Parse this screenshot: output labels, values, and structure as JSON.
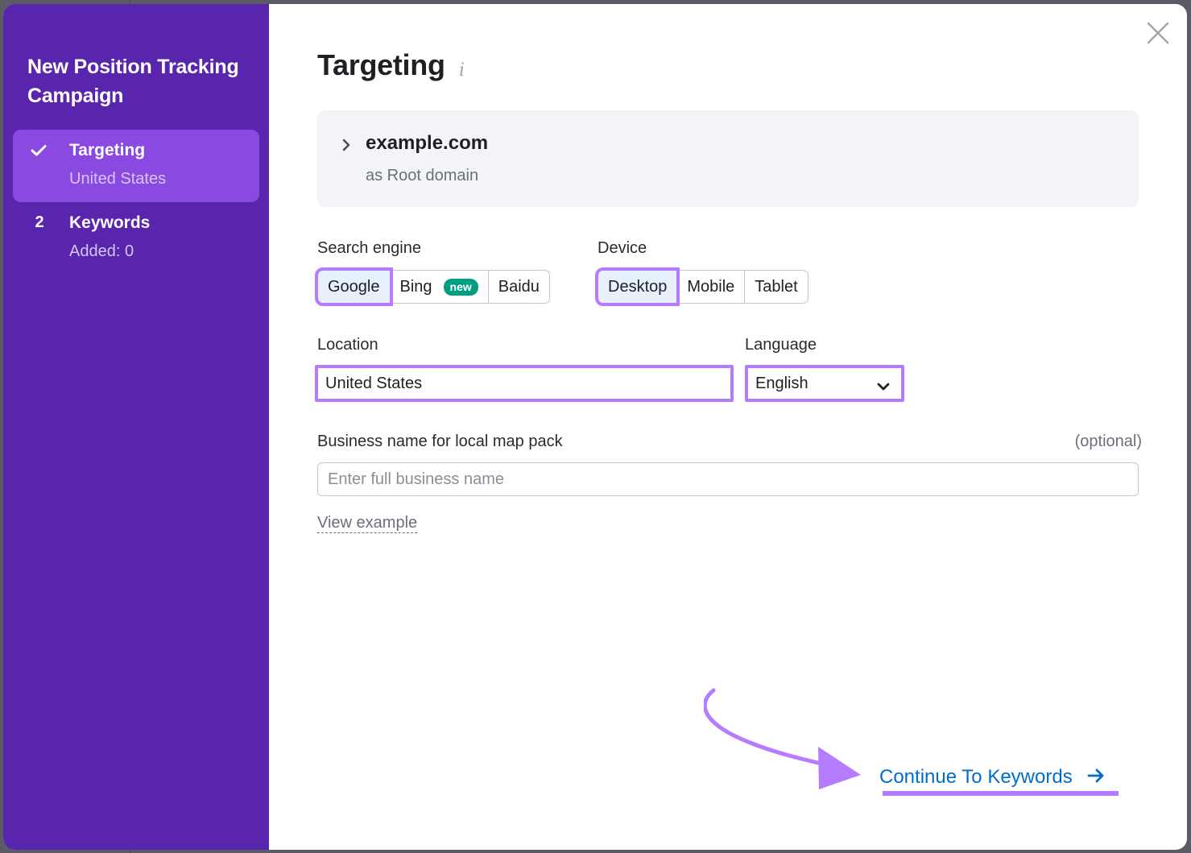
{
  "sidebar": {
    "title": "New Position Tracking Campaign",
    "steps": [
      {
        "marker": "check-icon",
        "label": "Targeting",
        "sub": "United States",
        "active": true
      },
      {
        "marker": "2",
        "label": "Keywords",
        "sub": "Added: 0",
        "active": false
      }
    ]
  },
  "main": {
    "title": "Targeting",
    "info_icon": "i",
    "domain": {
      "name": "example.com",
      "type": "as Root domain"
    },
    "search_engine": {
      "label": "Search engine",
      "options": [
        {
          "label": "Google",
          "selected": true
        },
        {
          "label": "Bing",
          "badge": "new",
          "selected": false
        },
        {
          "label": "Baidu",
          "selected": false
        }
      ]
    },
    "device": {
      "label": "Device",
      "options": [
        {
          "label": "Desktop",
          "selected": true
        },
        {
          "label": "Mobile",
          "selected": false
        },
        {
          "label": "Tablet",
          "selected": false
        }
      ]
    },
    "location": {
      "label": "Location",
      "value": "United States"
    },
    "language": {
      "label": "Language",
      "value": "English"
    },
    "business": {
      "label": "Business name for local map pack",
      "optional": "(optional)",
      "placeholder": "Enter full business name",
      "value": ""
    },
    "view_example": "View example",
    "continue_label": "Continue To Keywords",
    "continue_arrow": "→"
  },
  "colors": {
    "sidebar_bg": "#5925ad",
    "active_step_bg": "#8a49e0",
    "highlight": "#b67cff",
    "link": "#006dca",
    "badge": "#009f81",
    "selected_bg": "#e6f1fd"
  }
}
